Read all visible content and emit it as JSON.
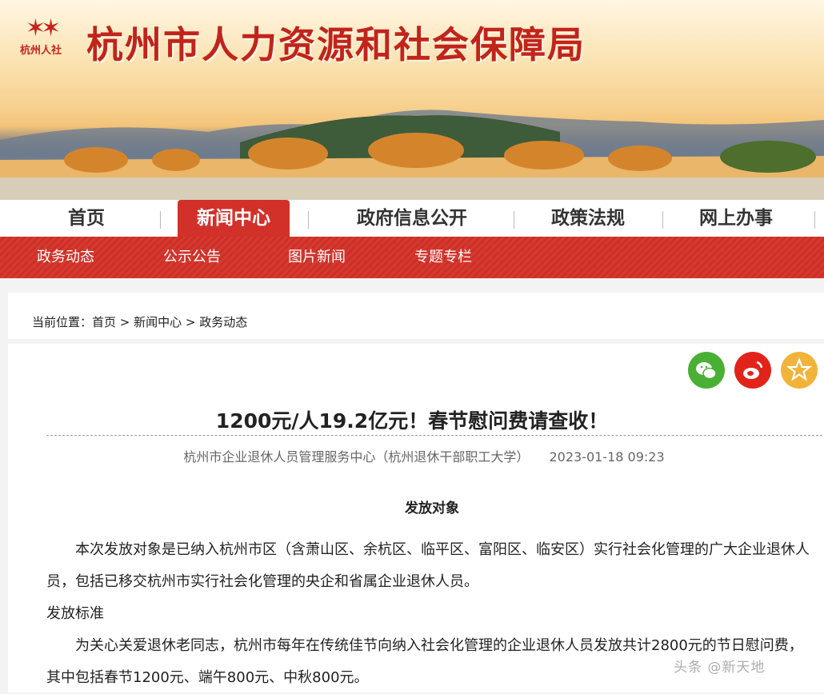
{
  "header": {
    "logo_text": "杭州人社",
    "site_title": "杭州市人力资源和社会保障局"
  },
  "nav": {
    "items": [
      {
        "label": "首页"
      },
      {
        "label": "新闻中心"
      },
      {
        "label": "政府信息公开"
      },
      {
        "label": "政策法规"
      },
      {
        "label": "网上办事"
      }
    ],
    "active": "新闻中心"
  },
  "subnav": {
    "items": [
      {
        "label": "政务动态"
      },
      {
        "label": "公示公告"
      },
      {
        "label": "图片新闻"
      },
      {
        "label": "专题专栏"
      }
    ]
  },
  "breadcrumb": {
    "text": "当前位置：首页 > 新闻中心 > 政务动态"
  },
  "share": {
    "icons": [
      "wechat-icon",
      "weibo-icon",
      "favorite-star-icon"
    ],
    "colors": {
      "wechat": "#4ab035",
      "weibo": "#e2231a",
      "favorite": "#f2b33b"
    }
  },
  "article": {
    "title": "1200元/人19.2亿元！春节慰问费请查收！",
    "source": "杭州市企业退休人员管理服务中心（杭州退休干部职工大学）",
    "date": "2023-01-18 09:23",
    "section1_title": "发放对象",
    "para1": "本次发放对象是已纳入杭州市区（含萧山区、余杭区、临平区、富阳区、临安区）实行社会化管理的广大企业退休人员，包括已移交杭州市实行社会化管理的央企和省属企业退休人员。",
    "section2_title": "发放标准",
    "para2": "为关心关爱退休老同志，杭州市每年在传统佳节向纳入社会化管理的企业退休人员发放共计2800元的节日慰问费，其中包括春节1200元、端午800元、中秋800元。"
  },
  "watermark": "头条 @新天地",
  "colors": {
    "brand_red": "#c1241a",
    "nav_active": "#d2312a"
  }
}
